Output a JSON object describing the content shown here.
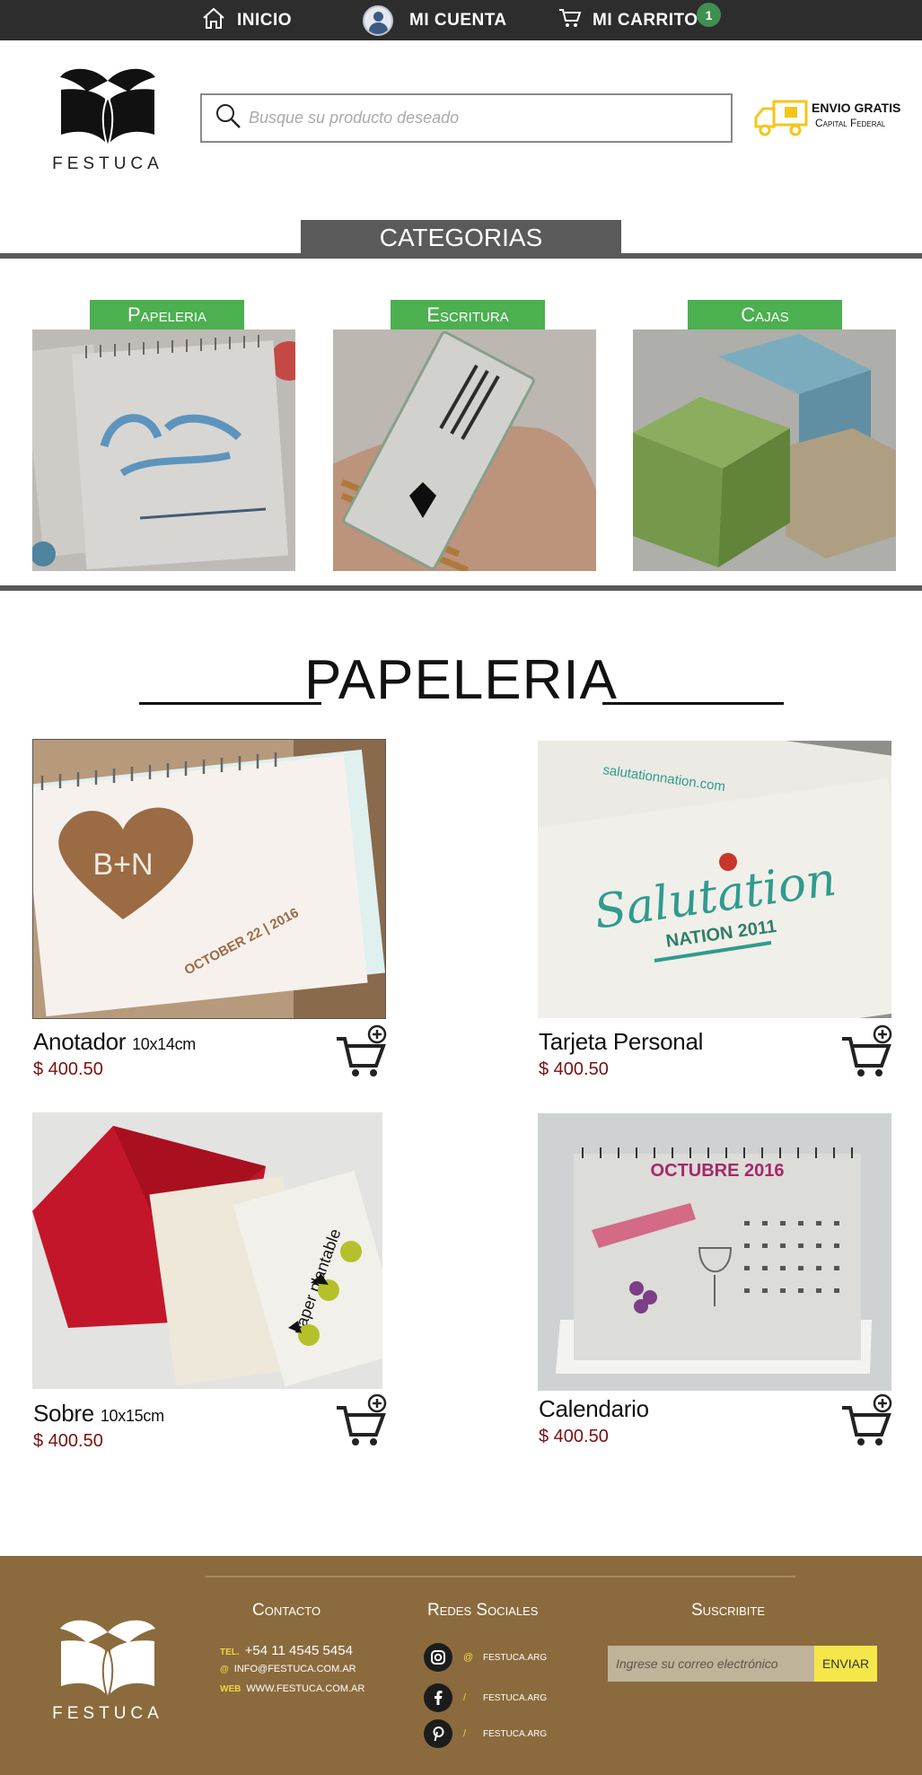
{
  "topbar": {
    "home_label": "INICIO",
    "account_label": "MI CUENTA",
    "cart_label": "MI CARRITO",
    "cart_count": "1"
  },
  "brand": {
    "name": "FESTUCA"
  },
  "search": {
    "placeholder": "Busque su producto deseado"
  },
  "shipping": {
    "line1": "ENVIO GRATIS",
    "line2": "Capital Federal"
  },
  "categories": {
    "title": "CATEGORIAS",
    "items": [
      {
        "label": "Papeleria"
      },
      {
        "label": "Escritura"
      },
      {
        "label": "Cajas"
      }
    ]
  },
  "section": {
    "title": "PAPELERIA"
  },
  "products": [
    {
      "name": "Anotador",
      "size": "10x14cm",
      "price": "$ 400.50",
      "image_text": [
        "B+N",
        "OCTOBER 22 | 2016"
      ]
    },
    {
      "name": "Tarjeta Personal",
      "size": "",
      "price": "$ 400.50",
      "image_text": [
        "salutationnation.com",
        "Salutation",
        "NATION 2011"
      ]
    },
    {
      "name": "Sobre",
      "size": "10x15cm",
      "price": "$ 400.50",
      "image_text": [
        "paper plantable"
      ]
    },
    {
      "name": "Calendario",
      "size": "",
      "price": "$ 400.50",
      "image_text": [
        "OCTUBRE 2016"
      ]
    }
  ],
  "footer": {
    "contact_title": "Contacto",
    "tel_tag": "TEL.",
    "tel": "+54 11 4545 5454",
    "email_tag": "@",
    "email": "INFO@FESTUCA.COM.AR",
    "web_tag": "WEB",
    "web": "WWW.FESTUCA.COM.AR",
    "social_title": "Redes Sociales",
    "social": [
      {
        "sep": "@",
        "handle": "FESTUCA.ARG",
        "icon": "instagram-icon"
      },
      {
        "sep": "/",
        "handle": "FESTUCA.ARG",
        "icon": "facebook-icon"
      },
      {
        "sep": "/",
        "handle": "FESTUCA.ARG",
        "icon": "pinterest-icon"
      }
    ],
    "subscribe_title": "Suscribite",
    "subscribe_placeholder": "Ingrese su correo electrónico",
    "subscribe_button": "ENVIAR"
  },
  "colors": {
    "topbar": "#2d2d2d",
    "category_green": "#4caf50",
    "footer": "#8b6b3d",
    "price": "#7a1010",
    "badge": "#3f8f50"
  }
}
